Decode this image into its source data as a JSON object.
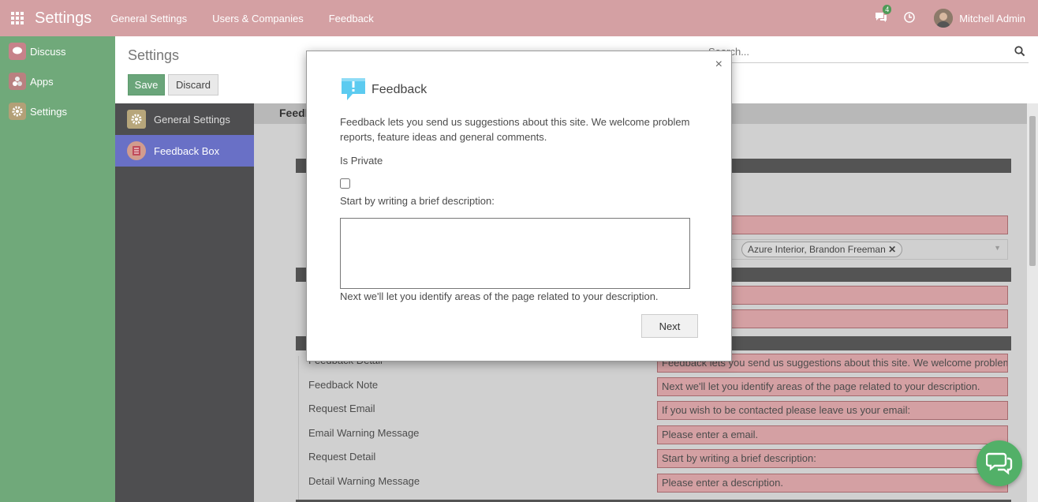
{
  "navbar": {
    "brand": "Settings",
    "menu": [
      "General Settings",
      "Users & Companies",
      "Feedback"
    ],
    "chat_count": "4",
    "user_name": "Mitchell Admin"
  },
  "apps": [
    {
      "label": "Discuss",
      "icon": "discuss-icon"
    },
    {
      "label": "Apps",
      "icon": "apps-icon"
    },
    {
      "label": "Settings",
      "icon": "settings-icon"
    }
  ],
  "control_panel": {
    "title": "Settings",
    "save_label": "Save",
    "discard_label": "Discard",
    "search_placeholder": "Search..."
  },
  "settings_sidebar": [
    {
      "label": "General Settings",
      "active": false
    },
    {
      "label": "Feedback Box",
      "active": true
    }
  ],
  "content": {
    "header": "Feedb",
    "tags": [
      "Azure Interior, Brandon Freeman"
    ],
    "rows": [
      {
        "label": "Feedback Detail",
        "value": "Feedback lets you send us suggestions about this site. We welcome problem reports, feature ideas and general comments."
      },
      {
        "label": "Feedback Note",
        "value": "Next we'll let you identify areas of the page related to your description."
      },
      {
        "label": "Request Email",
        "value": "If you wish to be contacted please leave us your email:"
      },
      {
        "label": "Email Warning Message",
        "value": "Please enter a email."
      },
      {
        "label": "Request Detail",
        "value": "Start by writing a brief description:"
      },
      {
        "label": "Detail Warning Message",
        "value": "Please enter a description."
      }
    ]
  },
  "dialog": {
    "title": "Feedback",
    "intro": "Feedback lets you send us suggestions about this site. We welcome problem reports, feature ideas and general comments.",
    "private_label": "Is Private",
    "desc_label": "Start by writing a brief description:",
    "note": "Next we'll let you identify areas of the page related to your description.",
    "next_label": "Next",
    "close_glyph": "×"
  },
  "colors": {
    "navbar": "#d4a0a3",
    "appbar": "#70a97a",
    "accent": "#6970c6",
    "field_highlight": "#d4a0a3",
    "chat_fab": "#52b068"
  }
}
